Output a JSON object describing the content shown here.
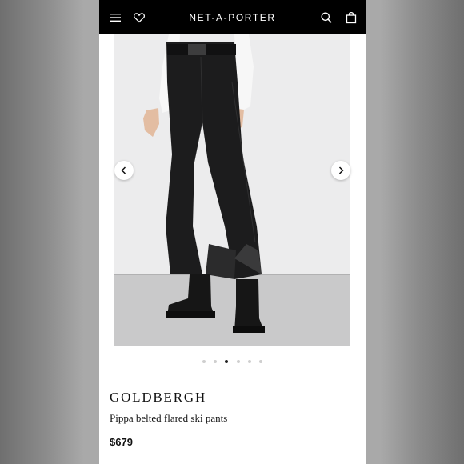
{
  "header": {
    "logo": "NET-A-PORTER",
    "icons": [
      "menu-icon",
      "heart-icon",
      "search-icon",
      "bag-icon"
    ],
    "background": "#000000"
  },
  "gallery": {
    "image_count": 6,
    "active_index": 2,
    "prev_icon": "chevron-left-icon",
    "next_icon": "chevron-right-icon"
  },
  "product": {
    "designer": "GOLDBERGH",
    "name": "Pippa belted flared ski pants",
    "price": "$679"
  }
}
